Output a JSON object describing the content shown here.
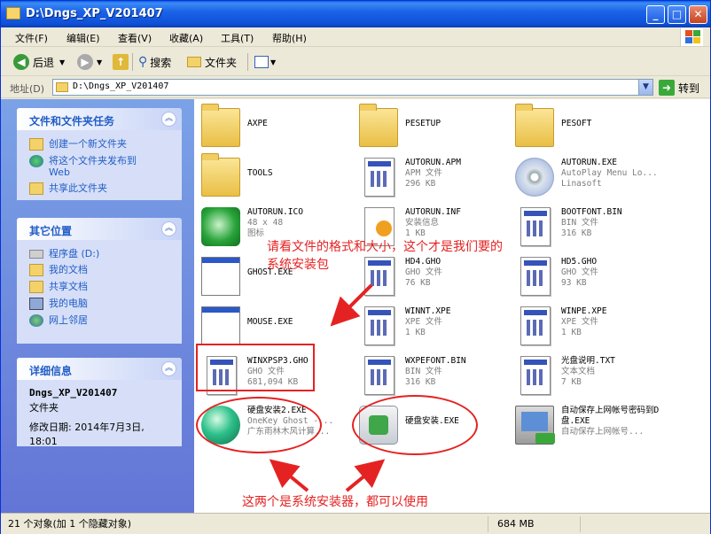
{
  "window": {
    "title": "D:\\Dngs_XP_V201407"
  },
  "menu": [
    "文件(F)",
    "编辑(E)",
    "查看(V)",
    "收藏(A)",
    "工具(T)",
    "帮助(H)"
  ],
  "toolbar": {
    "back": "后退",
    "search": "搜索",
    "folders": "文件夹"
  },
  "address": {
    "label": "地址(D)",
    "value": "D:\\Dngs_XP_V201407",
    "go": "转到"
  },
  "tasks": {
    "title": "文件和文件夹任务",
    "items": [
      "创建一个新文件夹",
      "将这个文件夹发布到 Web",
      "共享此文件夹"
    ]
  },
  "places": {
    "title": "其它位置",
    "items": [
      "程序盘 (D:)",
      "我的文档",
      "共享文档",
      "我的电脑",
      "网上邻居"
    ]
  },
  "details": {
    "title": "详细信息",
    "name": "Dngs_XP_V201407",
    "type": "文件夹",
    "modified_label": "修改日期: 2014年7月3日,",
    "modified_time": "18:01"
  },
  "files": [
    {
      "name": "AXPE",
      "line2": "",
      "line3": "",
      "icon": "folder-icon"
    },
    {
      "name": "PESETUP",
      "line2": "",
      "line3": "",
      "icon": "folder-icon"
    },
    {
      "name": "PESOFT",
      "line2": "",
      "line3": "",
      "icon": "folder-icon"
    },
    {
      "name": "TOOLS",
      "line2": "",
      "line3": "",
      "icon": "folder-icon"
    },
    {
      "name": "AUTORUN.APM",
      "line2": "APM 文件",
      "line3": "296 KB",
      "icon": "document-icon"
    },
    {
      "name": "AUTORUN.EXE",
      "line2": "AutoPlay Menu Lo...",
      "line3": "Linasoft",
      "icon": "cd-icon"
    },
    {
      "name": "AUTORUN.ICO",
      "line2": "48 x 48",
      "line3": "图标",
      "icon": "green-disc-icon"
    },
    {
      "name": "AUTORUN.INF",
      "line2": "安装信息",
      "line3": "1 KB",
      "icon": "setup-info-icon"
    },
    {
      "name": "BOOTFONT.BIN",
      "line2": "BIN 文件",
      "line3": "316 KB",
      "icon": "document-icon"
    },
    {
      "name": "GHOST.EXE",
      "line2": "",
      "line3": "",
      "icon": "window-icon"
    },
    {
      "name": "HD4.GHO",
      "line2": "GHO 文件",
      "line3": "76 KB",
      "icon": "document-icon"
    },
    {
      "name": "HD5.GHO",
      "line2": "GHO 文件",
      "line3": "93 KB",
      "icon": "document-icon"
    },
    {
      "name": "MOUSE.EXE",
      "line2": "",
      "line3": "",
      "icon": "window-icon"
    },
    {
      "name": "WINNT.XPE",
      "line2": "XPE 文件",
      "line3": "1 KB",
      "icon": "document-icon"
    },
    {
      "name": "WINPE.XPE",
      "line2": "XPE 文件",
      "line3": "1 KB",
      "icon": "document-icon"
    },
    {
      "name": "WINXPSP3.GHO",
      "line2": "GHO 文件",
      "line3": "681,094 KB",
      "icon": "document-icon"
    },
    {
      "name": "WXPEFONT.BIN",
      "line2": "BIN 文件",
      "line3": "316 KB",
      "icon": "document-icon"
    },
    {
      "name": "光盘说明.TXT",
      "line2": "文本文档",
      "line3": "7 KB",
      "icon": "document-icon"
    },
    {
      "name": "硬盘安装2.EXE",
      "line2": "OneKey Ghost -...",
      "line3": "广东雨林木风计算...",
      "icon": "onekey-ghost-icon"
    },
    {
      "name": "硬盘安装.EXE",
      "line2": "",
      "line3": "",
      "icon": "installer-icon"
    },
    {
      "name": "自动保存上网帐号密码到D盘.EXE",
      "line2": "",
      "line3": "自动保存上网帐号...",
      "icon": "computer-icon"
    }
  ],
  "annotations": {
    "top_1": "请看文件的格式和大小，这个才是我们要的",
    "top_2": "系统安装包",
    "bottom": "这两个是系统安装器，都可以使用"
  },
  "status": {
    "objects": "21 个对象(加 1 个隐藏对象)",
    "size": "684 MB"
  },
  "colors": {
    "title_bar": "#0a5fe0",
    "left_panel": "#7ba2e7",
    "link": "#215dc6",
    "annotation": "#e52222"
  }
}
